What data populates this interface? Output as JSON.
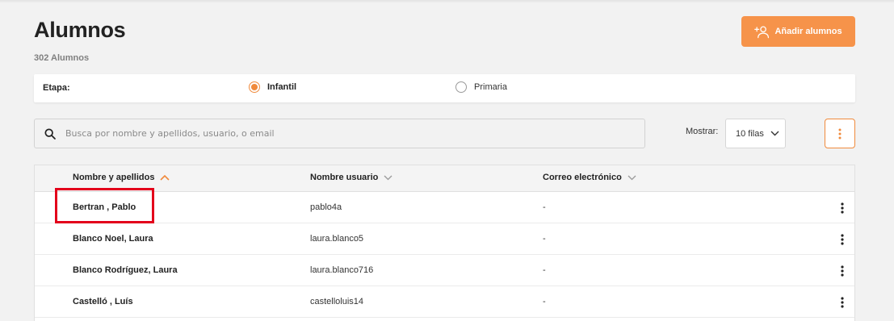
{
  "header": {
    "title": "Alumnos",
    "count": "302 Alumnos",
    "add_button": "Añadir alumnos",
    "add_icon": "add-user-icon"
  },
  "stage": {
    "label": "Etapa:",
    "options": [
      {
        "label": "Infantil",
        "selected": true
      },
      {
        "label": "Primaria",
        "selected": false
      }
    ]
  },
  "search": {
    "placeholder": "Busca por nombre y apellidos, usuario, o email",
    "value": "",
    "icon": "search-icon"
  },
  "pagination": {
    "show_label": "Mostrar:",
    "rows_value": "10 filas"
  },
  "table": {
    "columns": [
      {
        "label": "Nombre y apellidos",
        "sort": "asc"
      },
      {
        "label": "Nombre usuario",
        "sort": "none"
      },
      {
        "label": "Correo electrónico",
        "sort": "none"
      }
    ],
    "rows": [
      {
        "name": "Bertran , Pablo",
        "username": "pablo4a",
        "email": "-"
      },
      {
        "name": "Blanco Noel, Laura",
        "username": "laura.blanco5",
        "email": "-"
      },
      {
        "name": "Blanco Rodríguez, Laura",
        "username": "laura.blanco716",
        "email": "-"
      },
      {
        "name": "Castelló , Luís",
        "username": "castelloluis14",
        "email": "-"
      }
    ]
  },
  "colors": {
    "accent": "#f6934a",
    "highlight": "#e3001b",
    "background": "#f2f2f2"
  }
}
